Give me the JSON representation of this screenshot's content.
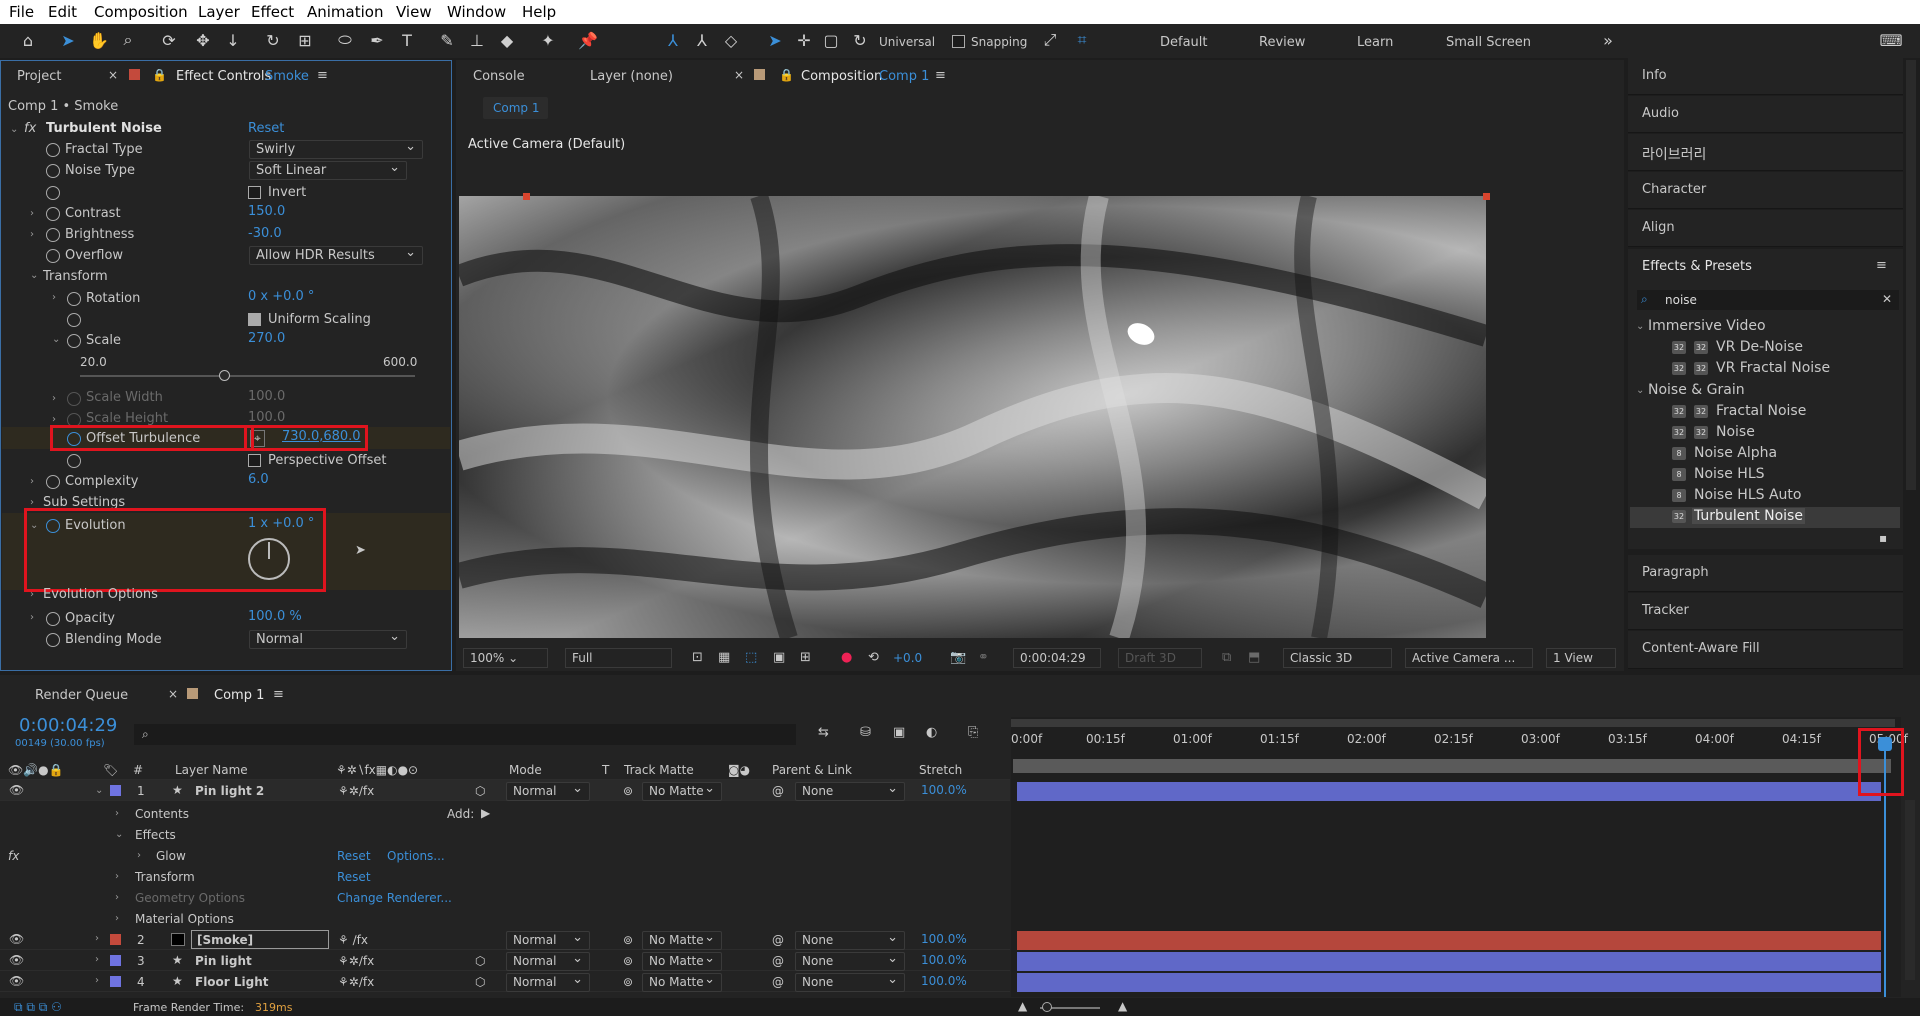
{
  "menu": [
    "File",
    "Edit",
    "Composition",
    "Layer",
    "Effect",
    "Animation",
    "View",
    "Window",
    "Help"
  ],
  "toolbar": {
    "universal": "Universal",
    "snapping": "Snapping",
    "workspaces": [
      "Default",
      "Review",
      "Learn",
      "Small Screen"
    ]
  },
  "left_tabs": {
    "project": "Project",
    "effect_controls": "Effect Controls",
    "effect_layer": "Smoke"
  },
  "effect_controls": {
    "breadcrumb": "Comp 1 • Smoke",
    "effect_name": "Turbulent Noise",
    "reset": "Reset",
    "fractal_type": {
      "label": "Fractal Type",
      "value": "Swirly"
    },
    "noise_type": {
      "label": "Noise Type",
      "value": "Soft Linear"
    },
    "invert": "Invert",
    "contrast": {
      "label": "Contrast",
      "value": "150.0"
    },
    "brightness": {
      "label": "Brightness",
      "value": "-30.0"
    },
    "overflow": {
      "label": "Overflow",
      "value": "Allow HDR Results"
    },
    "transform": "Transform",
    "rotation": {
      "label": "Rotation",
      "value": "0 x +0.0 °"
    },
    "uniform_scaling": "Uniform Scaling",
    "scale": {
      "label": "Scale",
      "value": "270.0",
      "min": "20.0",
      "max": "600.0",
      "fraction": 0.43
    },
    "scale_width": {
      "label": "Scale Width",
      "value": "100.0"
    },
    "scale_height": {
      "label": "Scale Height",
      "value": "100.0"
    },
    "offset_turbulence": {
      "label": "Offset Turbulence",
      "value": "730.0,680.0"
    },
    "perspective_offset": "Perspective Offset",
    "complexity": {
      "label": "Complexity",
      "value": "6.0"
    },
    "sub_settings": "Sub Settings",
    "evolution": {
      "label": "Evolution",
      "value": "1 x +0.0 °"
    },
    "evolution_options": "Evolution Options",
    "opacity": {
      "label": "Opacity",
      "value": "100.0 %"
    },
    "blending_mode": {
      "label": "Blending Mode",
      "value": "Normal"
    }
  },
  "center_tabs": {
    "console": "Console",
    "layer": "Layer (none)",
    "composition": "Composition",
    "comp_name": "Comp 1",
    "comp_chip": "Comp 1",
    "camera": "Active Camera (Default)"
  },
  "viewer_bar": {
    "zoom": "100%",
    "resolution": "Full",
    "exposure": "+0.0",
    "timecode": "0:00:04:29",
    "draft3d": "Draft 3D",
    "renderer": "Classic 3D",
    "camera": "Active Camera ...",
    "views": "1 View"
  },
  "right_panels": [
    "Info",
    "Audio",
    "라이브러리",
    "Character",
    "Align"
  ],
  "effects_presets": {
    "title": "Effects & Presets",
    "search": "noise",
    "groups": [
      {
        "name": "Immersive Video",
        "items": [
          "VR De-Noise",
          "VR Fractal Noise"
        ]
      },
      {
        "name": "Noise & Grain",
        "items": [
          "Fractal Noise",
          "Noise",
          "Noise Alpha",
          "Noise HLS",
          "Noise HLS Auto",
          "Turbulent Noise"
        ]
      }
    ]
  },
  "right_panels_lower": [
    "Paragraph",
    "Tracker",
    "Content-Aware Fill"
  ],
  "timeline": {
    "render_queue": "Render Queue",
    "comp_tab": "Comp 1",
    "timecode": "0:00:04:29",
    "frames": "00149 (30.00 fps)",
    "columns": {
      "num": "#",
      "layer_name": "Layer Name",
      "mode": "Mode",
      "t": "T",
      "track_matte": "Track Matte",
      "parent": "Parent & Link",
      "stretch": "Stretch"
    },
    "ruler": [
      "0:00f",
      "00:15f",
      "01:00f",
      "01:15f",
      "02:00f",
      "02:15f",
      "03:00f",
      "03:15f",
      "04:00f",
      "04:15f",
      "05:00f"
    ],
    "layers": [
      {
        "num": "1",
        "name": "Pin light 2",
        "mode": "Normal",
        "matte": "No Matte",
        "parent": "None",
        "stretch": "100.0%",
        "color": "#6f73e0"
      },
      {
        "num": "2",
        "name": "[Smoke]",
        "mode": "Normal",
        "matte": "No Matte",
        "parent": "None",
        "stretch": "100.0%",
        "color": "#c44a3c"
      },
      {
        "num": "3",
        "name": "Pin light",
        "mode": "Normal",
        "matte": "No Matte",
        "parent": "None",
        "stretch": "100.0%",
        "color": "#6f73e0"
      },
      {
        "num": "4",
        "name": "Floor Light",
        "mode": "Normal",
        "matte": "No Matte",
        "parent": "None",
        "stretch": "100.0%",
        "color": "#6f73e0"
      }
    ],
    "sub": {
      "contents": "Contents",
      "add": "Add:",
      "effects": "Effects",
      "glow": "Glow",
      "reset": "Reset",
      "options": "Options...",
      "transform": "Transform",
      "geometry": "Geometry Options",
      "change_renderer": "Change Renderer...",
      "material": "Material Options"
    },
    "search_placeholder": "",
    "frame_render_label": "Frame Render Time:",
    "frame_render_value": "319ms"
  }
}
